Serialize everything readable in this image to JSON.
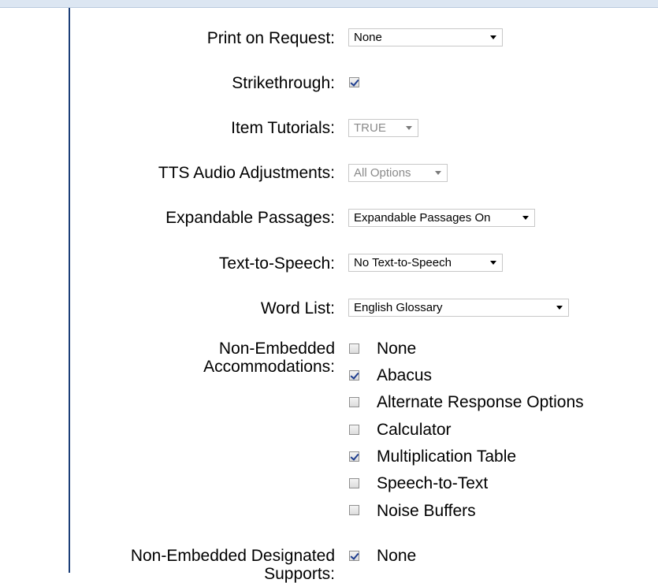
{
  "settings": {
    "print_on_request": {
      "label": "Print on Request:",
      "value": "None"
    },
    "strikethrough": {
      "label": "Strikethrough:",
      "checked": true
    },
    "item_tutorials": {
      "label": "Item Tutorials:",
      "value": "TRUE"
    },
    "tts_audio": {
      "label": "TTS Audio Adjustments:",
      "value": "All Options"
    },
    "expandable_passages": {
      "label": "Expandable Passages:",
      "value": "Expandable Passages On"
    },
    "text_to_speech": {
      "label": "Text-to-Speech:",
      "value": "No Text-to-Speech"
    },
    "word_list": {
      "label": "Word List:",
      "value": "English Glossary"
    },
    "non_embedded_accommodations": {
      "label_line1": "Non-Embedded",
      "label_line2": "Accommodations:",
      "options": [
        {
          "label": "None",
          "checked": false
        },
        {
          "label": "Abacus",
          "checked": true
        },
        {
          "label": "Alternate Response Options",
          "checked": false
        },
        {
          "label": "Calculator",
          "checked": false
        },
        {
          "label": "Multiplication Table",
          "checked": true
        },
        {
          "label": "Speech-to-Text",
          "checked": false
        },
        {
          "label": "Noise Buffers",
          "checked": false
        }
      ]
    },
    "non_embedded_designated_supports": {
      "label_line1": "Non-Embedded Designated",
      "label_line2": "Supports:",
      "options": [
        {
          "label": "None",
          "checked": true
        }
      ]
    }
  },
  "colors": {
    "accent": "#1c3f78",
    "header": "#dce6f2",
    "check": "#1e3d8f",
    "disabled_text": "#8a8a8a"
  }
}
